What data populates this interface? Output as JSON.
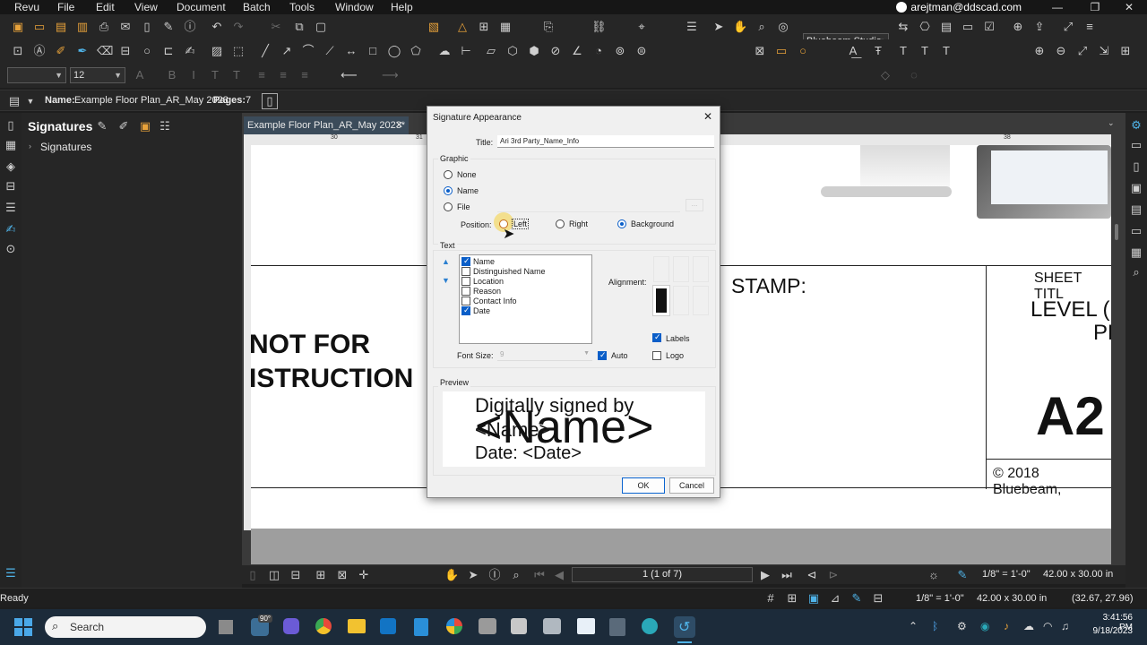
{
  "menu": {
    "items": [
      "Revu",
      "File",
      "Edit",
      "View",
      "Document",
      "Batch",
      "Tools",
      "Window",
      "Help"
    ]
  },
  "account": {
    "email": "arejtman@ddscad.com"
  },
  "toolbar": {
    "profile": "Bluebeam Studio",
    "font_size": "12"
  },
  "filebar": {
    "name_label": "Name:",
    "name_value": "Example Floor Plan_AR_May 2023",
    "pages_label": "Pages:",
    "pages_value": "7"
  },
  "leftpanel": {
    "title": "Signatures",
    "tree_item": "Signatures"
  },
  "doctab": {
    "label": "Example Floor Plan_AR_May 2023*"
  },
  "page": {
    "not_for": "NOT FOR",
    "construction": "ISTRUCTION",
    "stamp": "STAMP:",
    "sheet_title": "SHEET TITL",
    "level": "LEVEL (",
    "level2": "PL",
    "sheet_no": "A2",
    "copyright": "© 2018 Bluebeam,",
    "ruler_ticks": [
      "30",
      "31",
      "38"
    ]
  },
  "dialog": {
    "title": "Signature Appearance",
    "title_label": "Title:",
    "title_value": "Ari 3rd Party_Name_Info",
    "graphic_label": "Graphic",
    "graphic_options": [
      "None",
      "Name",
      "File"
    ],
    "position_label": "Position:",
    "position_options": [
      "Left",
      "Right",
      "Background"
    ],
    "text_label": "Text",
    "text_items": [
      {
        "label": "Name",
        "checked": true
      },
      {
        "label": "Distinguished Name",
        "checked": false
      },
      {
        "label": "Location",
        "checked": false
      },
      {
        "label": "Reason",
        "checked": false
      },
      {
        "label": "Contact Info",
        "checked": false
      },
      {
        "label": "Date",
        "checked": true
      }
    ],
    "alignment_label": "Alignment:",
    "labels_label": "Labels",
    "logo_label": "Logo",
    "font_size_label": "Font Size:",
    "font_size_value": "9",
    "auto_label": "Auto",
    "preview_label": "Preview",
    "preview_line1": "Digitally signed by",
    "preview_line2": "<Name>",
    "preview_big": "<Name>",
    "preview_line3": "Date: <Date>",
    "ok": "OK",
    "cancel": "Cancel"
  },
  "docnav": {
    "page_indicator": "1 (1 of 7)",
    "scale": "1/8\" = 1'-0\"",
    "size": "42.00 x 30.00 in"
  },
  "status": {
    "ready": "Ready",
    "scale": "1/8\" = 1'-0\"",
    "size": "42.00 x 30.00 in",
    "coords": "(32.67, 27.96)"
  },
  "taskbar": {
    "search": "Search",
    "weather": "90°",
    "time": "3:41:56 PM",
    "date": "9/18/2023"
  },
  "colors": {
    "accent": "#0a5ec8",
    "brand_orange": "#e8a23a",
    "taskbar": "#1c2b3a"
  }
}
